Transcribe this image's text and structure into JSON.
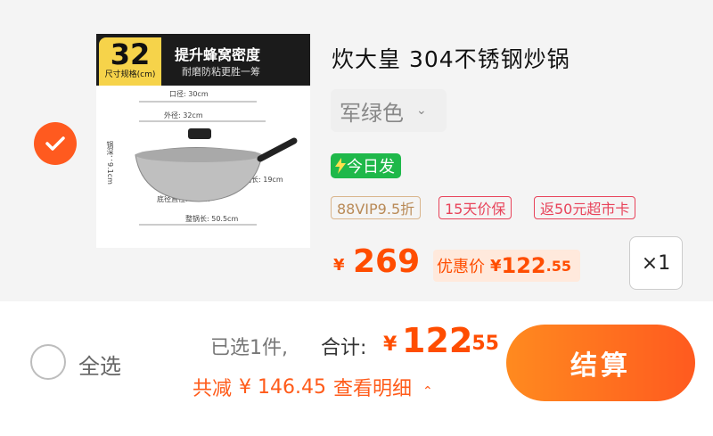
{
  "product": {
    "image_badge": {
      "size_num": "32",
      "size_unit": "尺寸规格(cm)",
      "title": "提升蜂窝密度",
      "subtitle": "耐磨防粘更胜一筹"
    },
    "image_dims": {
      "mouth": "口径: 30cm",
      "outer": "外径: 32cm",
      "height": "锅深：9.1cm",
      "handle": "手柄长: 19cm",
      "bottom": "底径直径: 14cm",
      "total": "整锅长: 50.5cm"
    },
    "title": "炊大皇 304不锈钢炒锅",
    "variant": "军绿色",
    "ship_tag": "今日发",
    "tags": [
      "88VIP9.5折",
      "15天价保",
      "返50元超市卡"
    ],
    "price_currency": "¥",
    "price": "269",
    "promo_label": "优惠价",
    "promo_currency": "¥",
    "promo_int": "122",
    "promo_dec": ".55",
    "quantity": "×1"
  },
  "footer": {
    "select_all": "全选",
    "selected_count": "已选1件,",
    "total_label": "合计:",
    "total_currency": "¥",
    "total_int": "122",
    "total_dec": ".55",
    "saved_label": "共减",
    "saved_amount": "¥ 146.45",
    "detail_link": "查看明细",
    "checkout": "结算"
  },
  "colors": {
    "accent": "#ff5a1f",
    "price": "#ff4d00",
    "ship": "#1fb84a",
    "tag_red": "#e8435a",
    "tag_gold": "#b98a57"
  }
}
